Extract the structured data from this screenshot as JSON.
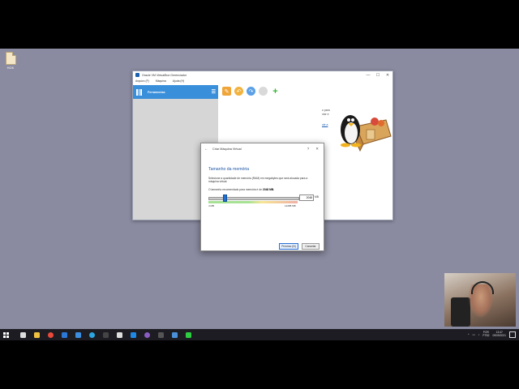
{
  "desktop": {
    "icon_label": "HGK"
  },
  "main_window": {
    "title": "Oracle VM VirtualBox Gerenciador",
    "menu": [
      "Arquivo (F)",
      "Máquina",
      "Ajuda (H)"
    ],
    "controls": [
      "—",
      "☐",
      "✕"
    ],
    "sidebar_tools_label": "Ferramentas",
    "welcome_lines": [
      "o para",
      "ctor e"
    ],
    "welcome_link": "ule a"
  },
  "dialog": {
    "title": "Criar Máquina Virtual",
    "help": "?",
    "close": "✕",
    "back": "←",
    "heading": "Tamanho da memória",
    "paragraph": "Selecione a quantidade de memória (RAM) em megabytes que será alocada para a máquina virtual.",
    "recommended_prefix": "O tamanho recomendado para memória é de",
    "recommended_value": "2048",
    "recommended_unit": "MB.",
    "memory_value": "2048",
    "memory_unit": "MB",
    "slider_min": "4 MB",
    "slider_max": "12288 MB",
    "slider_fraction": 0.167,
    "next_button": "Próximo (N)",
    "cancel_button": "Cancelar"
  },
  "taskbar": {
    "lang_top": "POR",
    "lang_bottom": "PTB2",
    "time": "13:47",
    "date": "09/09/2021"
  },
  "colors": {
    "desktop": "#8a8aa0",
    "accent": "#3a8fdb",
    "taskbar": "#1c1c22"
  }
}
